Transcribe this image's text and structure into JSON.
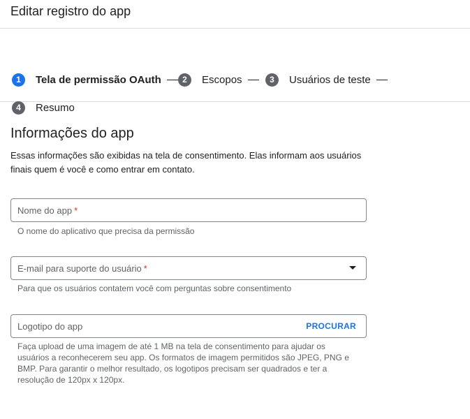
{
  "header": {
    "title": "Editar registro do app"
  },
  "stepper": {
    "steps": [
      {
        "number": "1",
        "label": "Tela de permissão OAuth"
      },
      {
        "number": "2",
        "label": "Escopos"
      },
      {
        "number": "3",
        "label": "Usuários de teste"
      },
      {
        "number": "4",
        "label": "Resumo"
      }
    ]
  },
  "section": {
    "title": "Informações do app",
    "description": "Essas informações são exibidas na tela de consentimento. Elas informam aos usuários finais quem é você e como entrar em contato."
  },
  "fields": {
    "app_name": {
      "label": "Nome do app",
      "required_mark": "*",
      "hint": "O nome do aplicativo que precisa da permissão"
    },
    "support_email": {
      "label": "E-mail para suporte do usuário",
      "required_mark": "*",
      "hint": "Para que os usuários contatem você com perguntas sobre consentimento"
    },
    "logo": {
      "label": "Logotipo do app",
      "button_label": "PROCURAR",
      "hint": "Faça upload de uma imagem de até 1 MB na tela de consentimento para ajudar os usuários a reconhecerem seu app. Os formatos de imagem permitidos são JPEG, PNG e BMP. Para garantir o melhor resultado, os logotipos precisam ser quadrados e ter a resolução de 120px x 120px."
    }
  },
  "colors": {
    "accent": "#1a73e8",
    "step_inactive": "#5f6368",
    "required": "#d93025",
    "border": "#80868b"
  }
}
